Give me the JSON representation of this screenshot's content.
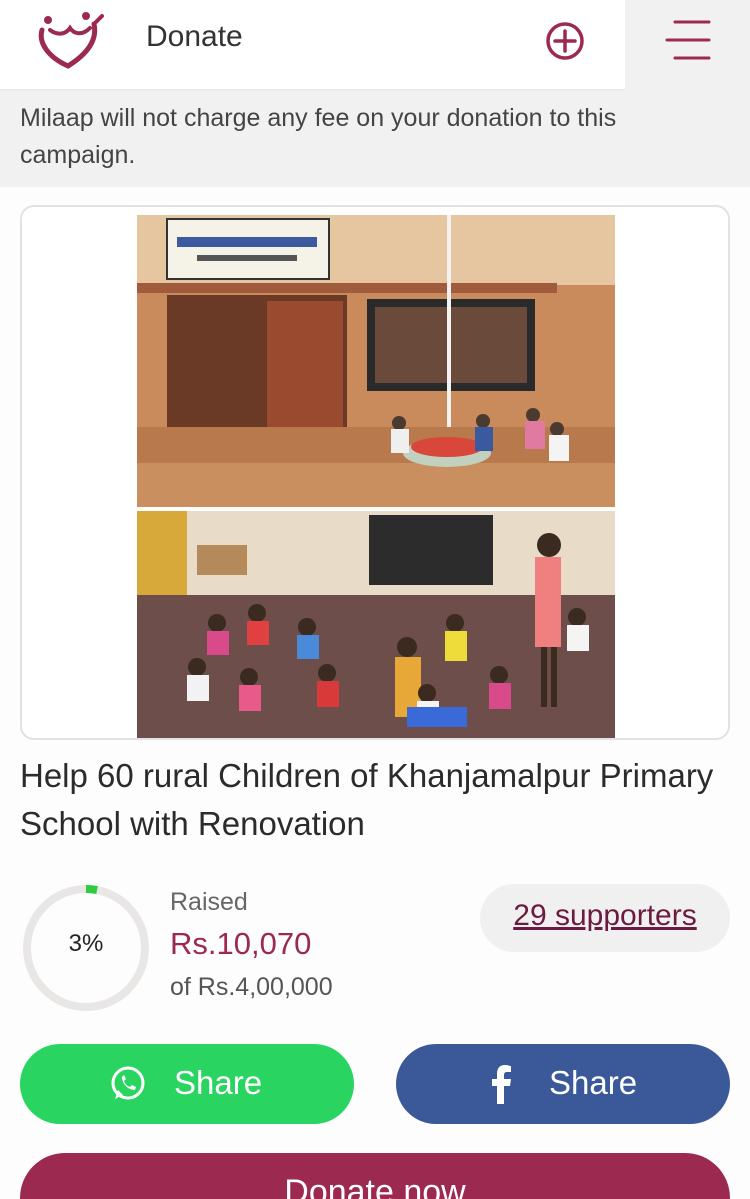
{
  "header": {
    "title": "Donate",
    "logo_icon": "milaap-heart-logo",
    "add_icon": "plus-circle-icon",
    "menu_icon": "hamburger-menu-icon"
  },
  "notice": {
    "text": "Milaap will not charge any fee on your donation to this campaign."
  },
  "campaign": {
    "title": "Help 60 rural Children of Khanjamalpur Primary School with Renovation",
    "progress_percent": "3%",
    "progress_fraction": 0.03,
    "raised_label": "Raised",
    "raised_amount": "Rs.10,070",
    "goal": "of Rs.4,00,000",
    "supporters": "29 supporters"
  },
  "actions": {
    "whatsapp_share": "Share",
    "facebook_share": "Share",
    "donate": "Donate now"
  },
  "colors": {
    "brand": "#9c2950",
    "whatsapp": "#2ad461",
    "facebook": "#3b5998",
    "progress": "#2ecc40",
    "track": "#e9e6e6"
  }
}
